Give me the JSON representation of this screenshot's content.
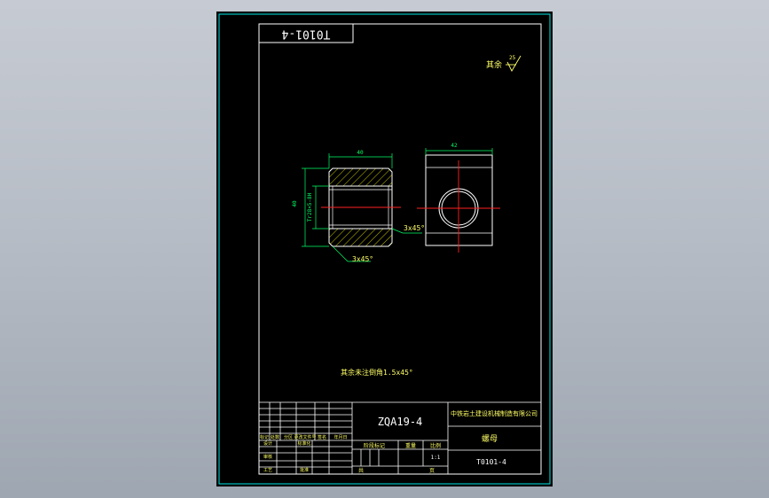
{
  "drawing": {
    "drawing_number_stamp": "T0101-4",
    "surface_finish_note": "其余",
    "surface_finish_value": "25",
    "technical_note": "其余未注倒角1.5x45°",
    "dimensions": {
      "front_width": "40",
      "front_height": "40",
      "thread": "Tr28×5-8H",
      "chamfer_top": "3x45°",
      "chamfer_bottom": "3x45°",
      "side_width": "42"
    },
    "title_block": {
      "project_code": "ZQA19-4",
      "company": "中铁岩土建设机械制造有限公司",
      "part_name": "螺母",
      "drawing_number": "T0101-4",
      "scale": "1:1",
      "stage_label": "阶段标记",
      "weight_label": "重量",
      "scale_label": "比例",
      "sheet_count_label": "共",
      "sheet_label": "页",
      "revision_row": [
        "标记",
        "处数",
        "分区",
        "更改文件号",
        "签名",
        "年月日"
      ],
      "designer_row": [
        "设计",
        "标准化"
      ],
      "checker_label": "审核",
      "process_label": "工艺",
      "approval_label": "批准"
    },
    "colors": {
      "frame": "#00e6e6",
      "outline": "#ffffff",
      "dimension": "#00ff66",
      "centerline": "#ff2020",
      "hatch": "#e6e600",
      "text": "#ffff66"
    }
  }
}
